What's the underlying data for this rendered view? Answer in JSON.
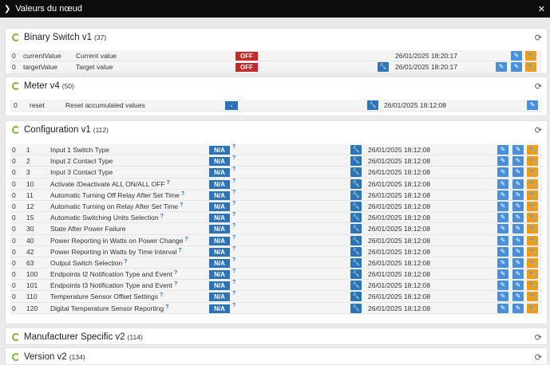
{
  "window": {
    "title": "Valeurs du nœud"
  },
  "icons": {
    "refresh": "refresh-icon",
    "wrench": "wrench-icon",
    "edit": "pencil-icon",
    "config": "wrench-icon-orange",
    "help": "question-icon"
  },
  "colors": {
    "off": "#c62828",
    "na": "#2c73b8",
    "edit": "#4a90d9",
    "config": "#f39c12",
    "ring": "#7cb342"
  },
  "binary_switch": {
    "title": "Binary Switch v1",
    "count": "(37)",
    "rows": [
      {
        "inst": "0",
        "key": "currentValue",
        "label": "Current value",
        "value": "OFF",
        "date": "26/01/2025 18:20:17"
      },
      {
        "inst": "0",
        "key": "targetValue",
        "label": "Target value",
        "value": "OFF",
        "date": "26/01/2025 18:20:17"
      }
    ]
  },
  "meter": {
    "title": "Meter v4",
    "count": "(50)",
    "rows": [
      {
        "inst": "0",
        "key": "reset",
        "label": "Reset accumulated values",
        "value": "-",
        "date": "26/01/2025 18:12:08"
      }
    ]
  },
  "configuration": {
    "title": "Configuration v1",
    "count": "(112)",
    "help_mark": "?",
    "rows": [
      {
        "inst": "0",
        "key": "1",
        "label": "Input 1 Switch Type",
        "value": "N/A",
        "date": "26/01/2025 18:12:08"
      },
      {
        "inst": "0",
        "key": "2",
        "label": "Input 2 Contact Type",
        "value": "N/A",
        "date": "26/01/2025 18:12:08"
      },
      {
        "inst": "0",
        "key": "3",
        "label": "Input 3 Contact Type",
        "value": "N/A",
        "date": "26/01/2025 18:12:08"
      },
      {
        "inst": "0",
        "key": "10",
        "label": "Activate /Deactivate ALL ON/ALL OFF",
        "value": "N/A",
        "date": "26/01/2025 18:12:08"
      },
      {
        "inst": "0",
        "key": "11",
        "label": "Automatic Turning Off Relay After Set Time",
        "value": "N/A",
        "date": "26/01/2025 18:12:08"
      },
      {
        "inst": "0",
        "key": "12",
        "label": "Automatic Turning on Relay After Set Time",
        "value": "N/A",
        "date": "26/01/2025 18:12:08"
      },
      {
        "inst": "0",
        "key": "15",
        "label": "Automatic Switching Units Selection",
        "value": "N/A",
        "date": "26/01/2025 18:12:08"
      },
      {
        "inst": "0",
        "key": "30",
        "label": "State After Power Failure",
        "value": "N/A",
        "date": "26/01/2025 18:12:08"
      },
      {
        "inst": "0",
        "key": "40",
        "label": "Power Reporting in Watts on Power Change",
        "value": "N/A",
        "date": "26/01/2025 18:12:08"
      },
      {
        "inst": "0",
        "key": "42",
        "label": "Power Reporting in Watts by Time Interval",
        "value": "N/A",
        "date": "26/01/2025 18:12:08"
      },
      {
        "inst": "0",
        "key": "63",
        "label": "Output Switch Selection",
        "value": "N/A",
        "date": "26/01/2025 18:12:08"
      },
      {
        "inst": "0",
        "key": "100",
        "label": "Endpoints I2 Notification Type and Event",
        "value": "N/A",
        "date": "26/01/2025 18:12:08"
      },
      {
        "inst": "0",
        "key": "101",
        "label": "Endpoints I3 Notification Type and Event",
        "value": "N/A",
        "date": "26/01/2025 18:12:08"
      },
      {
        "inst": "0",
        "key": "110",
        "label": "Temperature Sensor Offset Settings",
        "value": "N/A",
        "date": "26/01/2025 18:12:08"
      },
      {
        "inst": "0",
        "key": "120",
        "label": "Digital Temperature Sensor Reporting",
        "value": "N/A",
        "date": "26/01/2025 18:12:08"
      }
    ]
  },
  "manufacturer": {
    "title": "Manufacturer Specific v2",
    "count": "(114)"
  },
  "version": {
    "title": "Version v2",
    "count": "(134)"
  }
}
